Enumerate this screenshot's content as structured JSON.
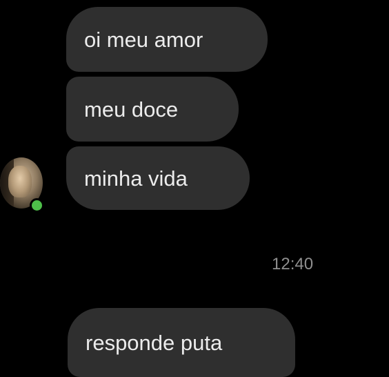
{
  "contact": {
    "avatar_icon": "contact-avatar",
    "online_status_color": "#4ec04a"
  },
  "received_messages": [
    {
      "text": "oi meu amor"
    },
    {
      "text": "meu doce"
    },
    {
      "text": "minha vida"
    }
  ],
  "timestamp": "12:40",
  "sent_messages": [
    {
      "text": "responde puta"
    }
  ],
  "colors": {
    "background": "#000000",
    "bubble": "#2f2f2f",
    "bubble_text": "#ececec",
    "timestamp_text": "#8f8f8f"
  }
}
